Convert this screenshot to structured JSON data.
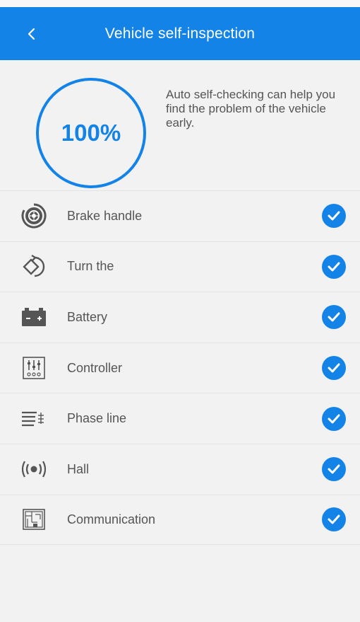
{
  "header": {
    "title": "Vehicle self-inspection",
    "back_icon": "chevron-left-icon"
  },
  "summary": {
    "percent": "100%",
    "description": "Auto self-checking can help you find the problem of the vehicle early."
  },
  "colors": {
    "primary": "#1483e8",
    "background": "#f2f2f2",
    "text": "#555555",
    "icon": "#555555"
  },
  "items": [
    {
      "label": "Brake handle",
      "icon": "brake-disc-icon",
      "status": "check-icon"
    },
    {
      "label": "Turn the",
      "icon": "turn-arrow-icon",
      "status": "check-icon"
    },
    {
      "label": "Battery",
      "icon": "battery-icon",
      "status": "check-icon"
    },
    {
      "label": "Controller",
      "icon": "controller-icon",
      "status": "check-icon"
    },
    {
      "label": "Phase line",
      "icon": "phase-line-icon",
      "status": "check-icon"
    },
    {
      "label": "Hall",
      "icon": "hall-sensor-icon",
      "status": "check-icon"
    },
    {
      "label": "Communication",
      "icon": "communication-icon",
      "status": "check-icon"
    }
  ]
}
